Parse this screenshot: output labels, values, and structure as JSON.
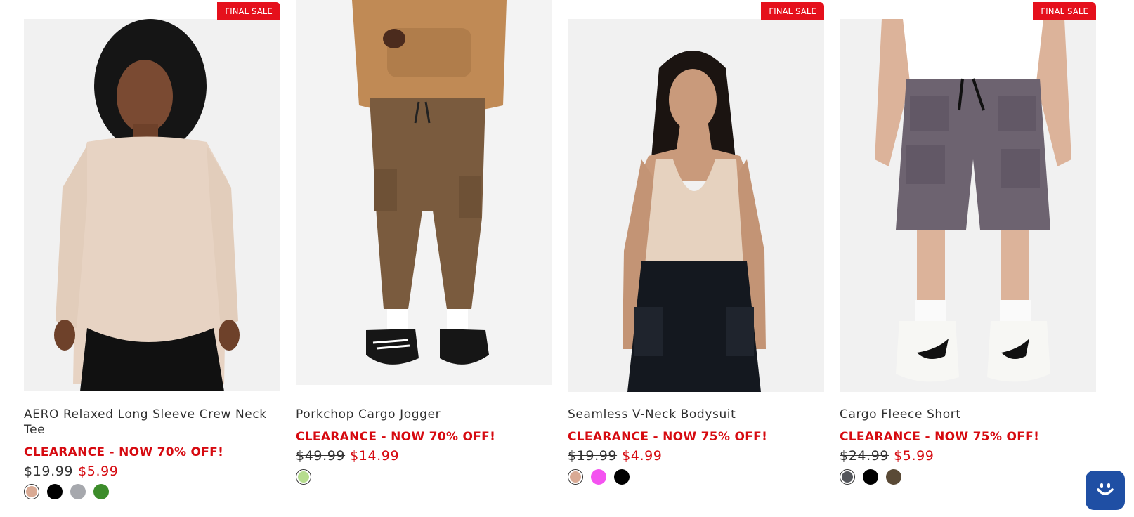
{
  "products": [
    {
      "badge": "FINAL SALE",
      "name": "AERO Relaxed Long Sleeve Crew Neck Tee",
      "promo": "CLEARANCE - NOW 70% OFF!",
      "original_price": "$19.99",
      "sale_price": "$5.99",
      "swatches": [
        "#d9aa94",
        "#000000",
        "#a6a8ad",
        "#3c8c2a"
      ],
      "image_alt": "Woman wearing a beige relaxed long sleeve crew neck tee"
    },
    {
      "badge": "",
      "name": "Porkchop Cargo Jogger",
      "promo": "CLEARANCE - NOW 70% OFF!",
      "original_price": "$49.99",
      "sale_price": "$14.99",
      "swatches": [
        "#b6dc8e"
      ],
      "image_alt": "Brown cargo jogger pants with black sneakers"
    },
    {
      "badge": "FINAL SALE",
      "name": "Seamless V-Neck Bodysuit",
      "promo": "CLEARANCE - NOW 75% OFF!",
      "original_price": "$19.99",
      "sale_price": "$4.99",
      "swatches": [
        "#d9aa94",
        "#f452f0",
        "#000000"
      ],
      "image_alt": "Woman wearing a beige seamless v-neck bodysuit"
    },
    {
      "badge": "FINAL SALE",
      "name": "Cargo Fleece Short",
      "promo": "CLEARANCE - NOW 75% OFF!",
      "original_price": "$24.99",
      "sale_price": "$5.99",
      "swatches": [
        "#55575c",
        "#000000",
        "#5a4a36"
      ],
      "image_alt": "Grey cargo fleece shorts with white sneakers"
    }
  ],
  "chat": {
    "icon": "chat-smile-icon",
    "color": "#1f4fa4"
  },
  "colors": {
    "sale_red": "#d60a10",
    "badge_red": "#e5101c"
  }
}
